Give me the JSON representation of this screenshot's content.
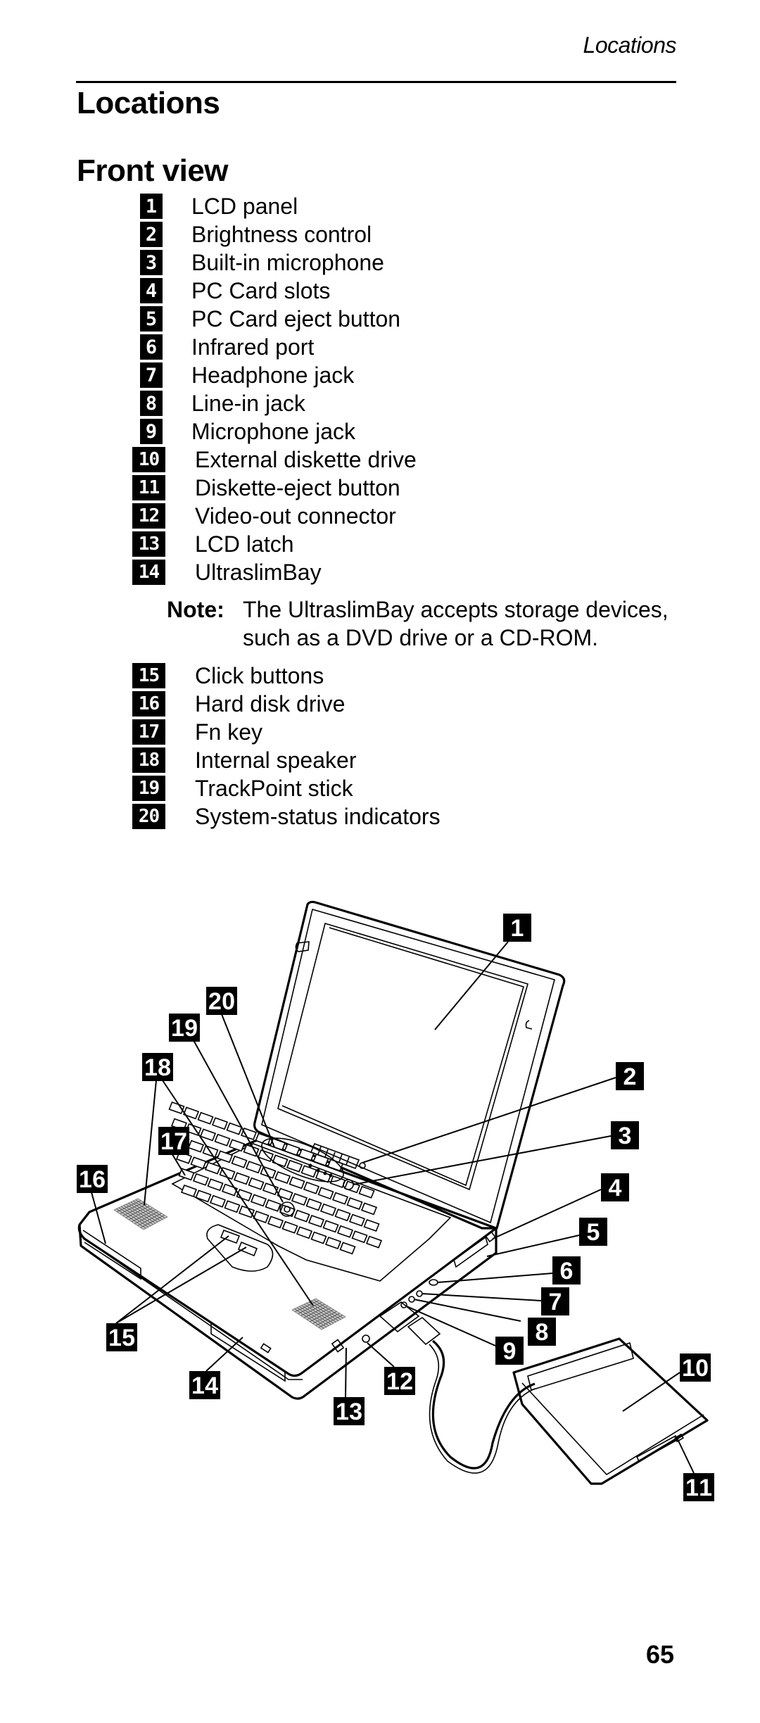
{
  "running_head": "Locations",
  "section_title": "Locations",
  "subsection_title": "Front view",
  "items": [
    {
      "num": "1",
      "label": "LCD panel"
    },
    {
      "num": "2",
      "label": "Brightness control"
    },
    {
      "num": "3",
      "label": "Built-in microphone"
    },
    {
      "num": "4",
      "label": "PC Card slots"
    },
    {
      "num": "5",
      "label": "PC Card eject button"
    },
    {
      "num": "6",
      "label": "Infrared port"
    },
    {
      "num": "7",
      "label": "Headphone jack"
    },
    {
      "num": "8",
      "label": "Line-in jack"
    },
    {
      "num": "9",
      "label": "Microphone jack"
    },
    {
      "num": "10",
      "label": "External diskette drive"
    },
    {
      "num": "11",
      "label": "Diskette-eject button"
    },
    {
      "num": "12",
      "label": "Video-out connector"
    },
    {
      "num": "13",
      "label": "LCD latch"
    },
    {
      "num": "14",
      "label": "UltraslimBay"
    },
    {
      "num": "15",
      "label": "Click buttons"
    },
    {
      "num": "16",
      "label": "Hard disk drive"
    },
    {
      "num": "17",
      "label": "Fn key"
    },
    {
      "num": "18",
      "label": "Internal speaker"
    },
    {
      "num": "19",
      "label": "TrackPoint stick"
    },
    {
      "num": "20",
      "label": "System-status indicators"
    }
  ],
  "note": {
    "label": "Note:",
    "text": "The UltraslimBay accepts storage devices, such as a DVD drive or a CD-ROM."
  },
  "figure": {
    "description": "Laptop front view with numbered callouts and external diskette drive",
    "callouts": [
      "1",
      "2",
      "3",
      "4",
      "5",
      "6",
      "7",
      "8",
      "9",
      "10",
      "11",
      "12",
      "13",
      "14",
      "15",
      "16",
      "17",
      "18",
      "19",
      "20"
    ]
  },
  "page_number": "65"
}
